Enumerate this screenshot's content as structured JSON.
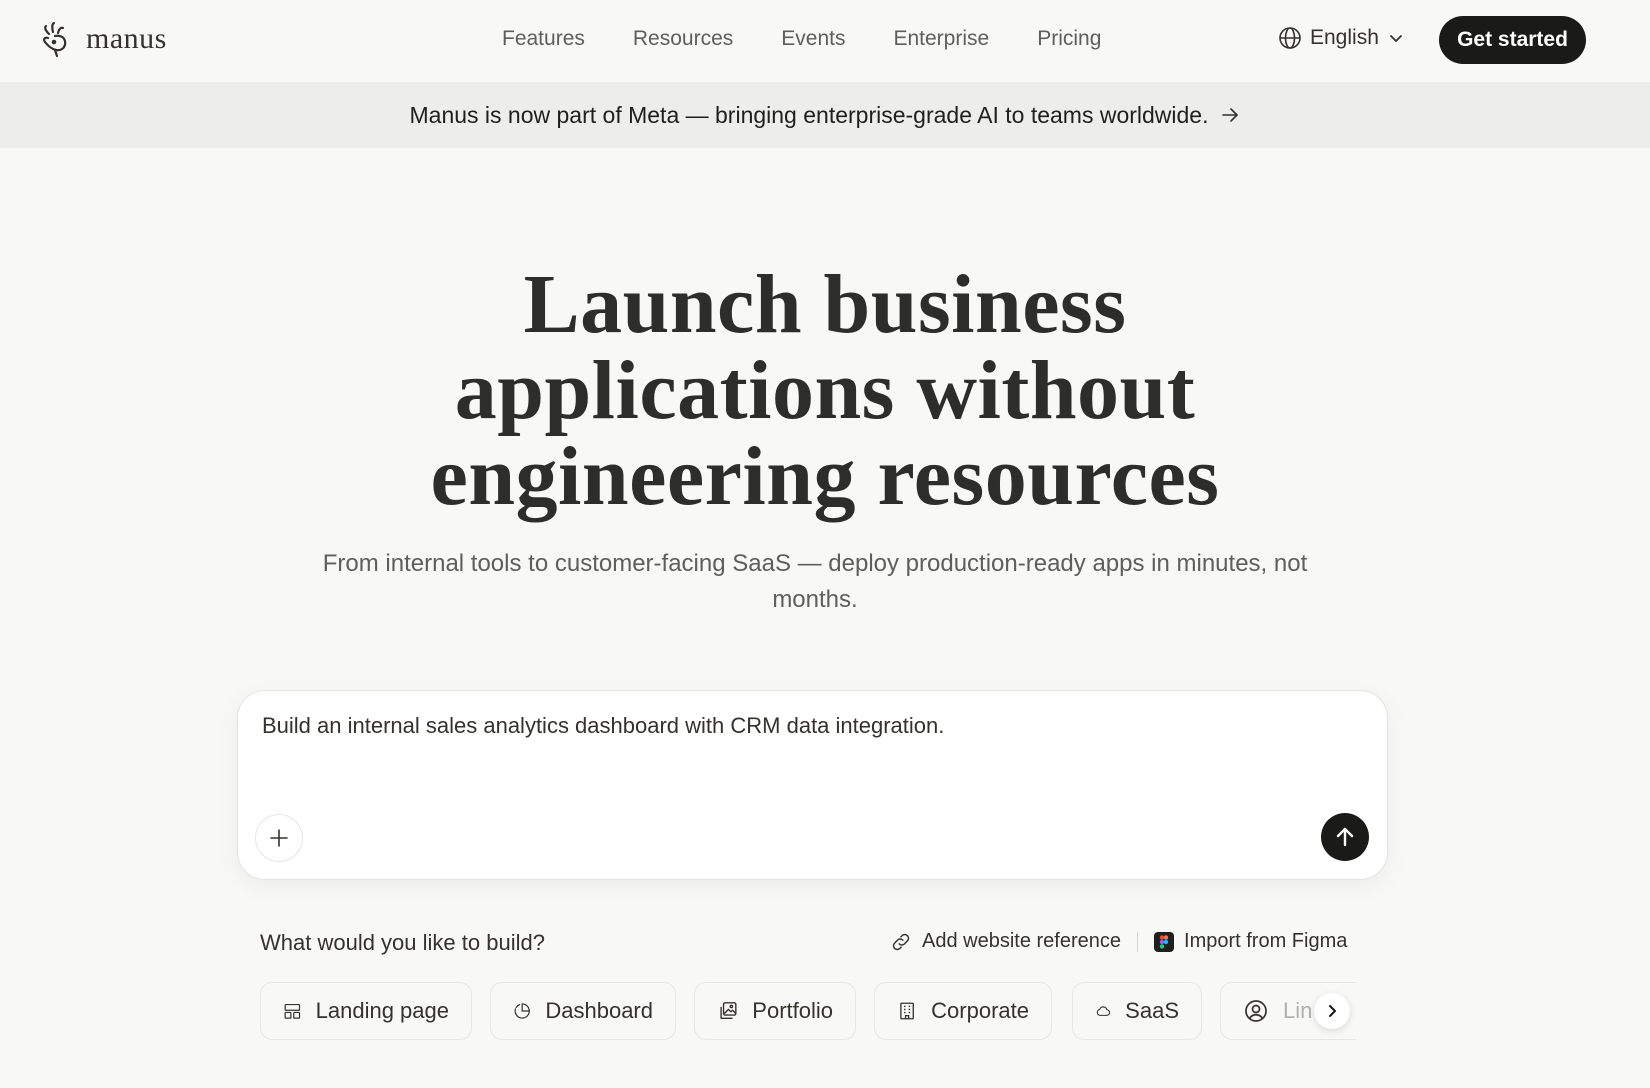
{
  "nav": {
    "logo_text": "manus",
    "links": [
      "Features",
      "Resources",
      "Events",
      "Enterprise",
      "Pricing"
    ],
    "language": "English",
    "cta_label": "Get started"
  },
  "banner": {
    "text": "Manus is now part of Meta — bringing enterprise-grade AI to teams worldwide.",
    "arrow_icon": "arrow-right-icon"
  },
  "hero": {
    "title_line1": "Launch business",
    "title_line2": "applications without",
    "title_line3": "engineering resources",
    "subtitle": "From internal tools to customer-facing SaaS — deploy production-ready apps in minutes, not months."
  },
  "prompt": {
    "value": "Build an internal sales analytics dashboard with CRM data integration.",
    "add_icon": "plus-icon",
    "send_icon": "arrow-up-icon"
  },
  "build": {
    "label": "What would you like to build?",
    "add_reference_label": "Add website reference",
    "import_figma_label": "Import from Figma",
    "chips": [
      {
        "label": "Landing page",
        "icon": "layout-icon"
      },
      {
        "label": "Dashboard",
        "icon": "pie-chart-icon"
      },
      {
        "label": "Portfolio",
        "icon": "images-icon"
      },
      {
        "label": "Corporate",
        "icon": "building-icon"
      },
      {
        "label": "SaaS",
        "icon": "cloud-icon"
      },
      {
        "label": "Lin",
        "icon": "user-circle-icon"
      }
    ]
  },
  "colors": {
    "background": "#f8f8f7",
    "banner_bg": "#ededec",
    "primary_dark": "#1a1a19",
    "text": "#34322d"
  }
}
